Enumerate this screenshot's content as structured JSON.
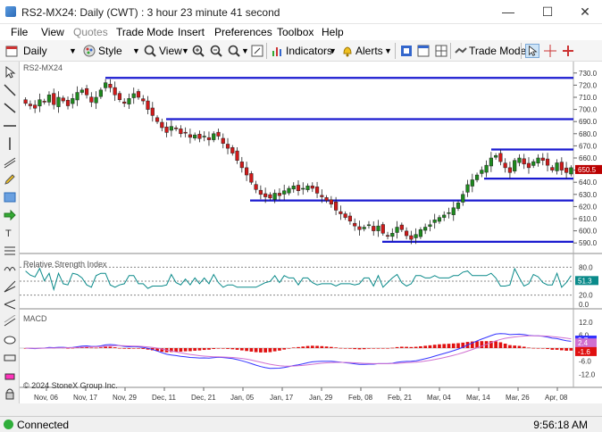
{
  "window": {
    "title": "RS2-MX24: Daily (CWT) : 3 hour 23 minute 41 second"
  },
  "menu": [
    "File",
    "View",
    "Quotes",
    "Trade Mode",
    "Insert",
    "Preferences",
    "Toolbox",
    "Help"
  ],
  "toolbar": {
    "period": "Daily",
    "style": "Style",
    "view": "View",
    "indicators": "Indicators",
    "alerts": "Alerts",
    "trade_mode": "Trade Mode"
  },
  "chart": {
    "symbol_label": "RS2-MX24",
    "rsi_label": "Relative Strength Index",
    "macd_label": "MACD",
    "copyright": "© 2024 StoneX Group Inc.",
    "price_ticks": [
      "730.0",
      "720.0",
      "710.0",
      "700.0",
      "690.0",
      "680.0",
      "670.0",
      "660.0",
      "650.0",
      "640.0",
      "630.0",
      "620.0",
      "610.0",
      "600.0",
      "590.0"
    ],
    "current_price": "650.5",
    "rsi_ticks": [
      "80.0",
      "50.0",
      "20.0",
      "0.0"
    ],
    "rsi_value": "51.3",
    "macd_ticks": [
      "12.0",
      "6.0",
      "-6.0",
      "-12.0"
    ],
    "macd_value1": "3.7",
    "macd_value2": "2.4",
    "macd_hist_value": "-1.6",
    "date_labels": [
      "Nov, 06",
      "Nov, 17",
      "Nov, 29",
      "Dec, 11",
      "Dec, 21",
      "Jan, 05",
      "Jan, 17",
      "Jan, 29",
      "Feb, 08",
      "Feb, 21",
      "Mar, 04",
      "Mar, 14",
      "Mar, 26",
      "Apr, 08"
    ],
    "colors": {
      "up": "#1d8a1d",
      "down": "#d11a1a",
      "hline": "#1a1ad0",
      "macd": "#3333ff",
      "signal": "#d070d0",
      "rsi": "#0a8a8a"
    }
  },
  "chart_data": {
    "type": "candlestick",
    "ylim": [
      585,
      735
    ],
    "horizontal_levels": [
      726,
      692,
      667,
      643,
      625,
      591
    ],
    "closes": [
      705,
      703,
      701,
      708,
      706,
      712,
      704,
      710,
      707,
      703,
      709,
      714,
      716,
      712,
      706,
      710,
      716,
      722,
      718,
      712,
      708,
      705,
      709,
      713,
      710,
      707,
      700,
      695,
      690,
      685,
      681,
      686,
      684,
      680,
      681,
      677,
      679,
      676,
      678,
      675,
      680,
      678,
      672,
      668,
      664,
      658,
      652,
      646,
      640,
      634,
      630,
      628,
      627,
      631,
      629,
      633,
      635,
      637,
      633,
      635,
      637,
      635,
      631,
      628,
      625,
      622,
      617,
      614,
      611,
      608,
      604,
      601,
      603,
      605,
      600,
      604,
      598,
      596,
      598,
      603,
      601,
      596,
      593,
      597,
      601,
      603,
      605,
      609,
      611,
      613,
      615,
      619,
      623,
      630,
      638,
      642,
      646,
      650,
      654,
      660,
      662,
      657,
      652,
      648,
      658,
      660,
      655,
      652,
      657,
      660,
      658,
      654,
      650,
      656,
      650,
      648,
      652
    ]
  },
  "status": {
    "connection": "Connected",
    "time": "9:56:18 AM"
  }
}
